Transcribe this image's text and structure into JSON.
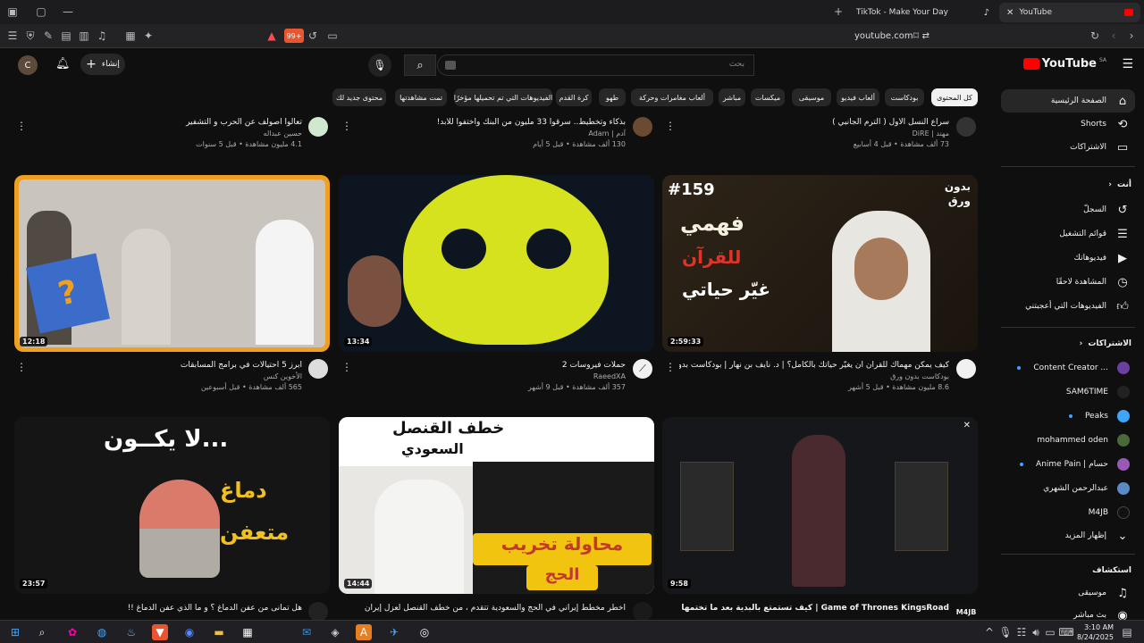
{
  "browser": {
    "tabs": [
      {
        "title": "YouTube",
        "active": true
      },
      {
        "title": "TikTok - Make Your Day",
        "active": false
      }
    ],
    "url": "youtube.com",
    "shield_count": "99+"
  },
  "masthead": {
    "search_placeholder": "بحث",
    "create_label": "إنشاء",
    "avatar_letter": "C",
    "logo_text": "YouTube",
    "logo_region": "SA"
  },
  "chips": [
    "كل المحتوى",
    "بودكاست",
    "ألعاب فيديو",
    "موسيقى",
    "ميكسات",
    "مباشر",
    "ألعاب مغامرات وحركة",
    "طهو",
    "كرة القدم",
    "الفيديوهات التي تم تحميلها مؤخرًا",
    "تمت مشاهدتها",
    "محتوى جديد لك"
  ],
  "sidebar": {
    "main": [
      {
        "label": "الصفحة الرئيسية",
        "icon": "home-icon"
      },
      {
        "label": "Shorts",
        "icon": "shorts-icon"
      },
      {
        "label": "الاشتراكات",
        "icon": "subscriptions-icon"
      }
    ],
    "you_title": "أنت",
    "you": [
      {
        "label": "السجلّ",
        "icon": "history-icon"
      },
      {
        "label": "قوائم التشغيل",
        "icon": "playlist-icon"
      },
      {
        "label": "فيديوهاتك",
        "icon": "your-videos-icon"
      },
      {
        "label": "المشاهدة لاحقًا",
        "icon": "watch-later-icon"
      },
      {
        "label": "الفيديوهات التي أعجبتني",
        "icon": "like-icon"
      }
    ],
    "subs_title": "الاشتراكات",
    "subs": [
      {
        "label": "Content Creator ...",
        "color": "#6b3fa0",
        "live": true
      },
      {
        "label": "SAM6TIME",
        "color": "#222222",
        "live": false
      },
      {
        "label": "Peaks",
        "color": "#3ea6ff",
        "live": true
      },
      {
        "label": "mohammed oden",
        "color": "#4a6a3a",
        "live": false
      },
      {
        "label": "Anime Pain | حسام",
        "color": "#9b59b6",
        "live": true
      },
      {
        "label": "عبدالرحمن الشهري",
        "color": "#5a8ac6",
        "live": false
      },
      {
        "label": "M4JB",
        "color": "#111111",
        "live": false
      }
    ],
    "show_more": "إظهار المزيد",
    "explore_title": "استكشاف",
    "explore": [
      {
        "label": "موسيقى",
        "icon": "music-icon"
      },
      {
        "label": "بث مباشر",
        "icon": "live-icon"
      }
    ]
  },
  "top_row": [
    {
      "title": "سراع النسل الأول ( الترم الجانبي )",
      "channel": "مهند | DiRE",
      "stats": "73 ألف مشاهدة • قبل 4 أسابيع",
      "avatar_color": "#333333"
    },
    {
      "title": "بذكاء وتخطيط.. سرقوا 33 مليون من البنك واختفوا للأبد!",
      "channel": "آدم | Adam",
      "stats": "130 ألف مشاهدة • قبل 5 أيام",
      "avatar_color": "#6a4a30"
    },
    {
      "title": "تعالوا أصولف عن الحرب و التشفير",
      "channel": "حسين عبداله",
      "stats": "4.1 مليون مشاهدة • قبل 5 سنوات",
      "avatar_color": "#cfe8cf"
    }
  ],
  "videos": [
    {
      "title": "كيف يمكن مهماك للقرآن أن يغيّر حياتك بالكامل؟ | د. نايف بن نهار | بودكاست بدون ورق",
      "channel": "بودكاست بدون ورق",
      "stats": "8.6 مليون مشاهدة • قبل 5 أشهر",
      "duration": "2:59:33",
      "avatar_color": "#f1f1f1",
      "thumb_text": [
        "#159",
        "فهمي",
        "للقرآن",
        "غيّر حياتي",
        "بدون",
        "ورق"
      ]
    },
    {
      "title": "حملات فيروسات 2",
      "channel": "RaeedXA",
      "stats": "357 ألف مشاهدة • قبل 9 أشهر",
      "duration": "13:34",
      "avatar_color": "#f1f1f1",
      "thumb_text": []
    },
    {
      "title": "أبرز 5 احتيالات في برامج المسابقات",
      "channel": "الأخوين كنس",
      "stats": "565 ألف مشاهدة • قبل أسبوعين",
      "duration": "12:18",
      "avatar_color": "#dddddd",
      "thumb_text": [
        "?"
      ]
    },
    {
      "title": "Game of Thrones KingsRoad | كيف تستمتع بالبدية بعد ما تختمها لحية",
      "channel": "M4JB",
      "stats": "",
      "duration": "9:58",
      "avatar_color": "#111111",
      "thumb_text": []
    },
    {
      "title": "أخطر مخطط إيراني في الحج والسعودية تتقدم ، من خطف القنصل لعزل إيران",
      "channel": "",
      "stats": "",
      "duration": "14:44",
      "avatar_color": "#1a1a1a",
      "thumb_text": [
        "خطف القنصل",
        "السعودي",
        "محاولة تخريب",
        "الحج"
      ]
    },
    {
      "title": "هل تمانى من عفن الدماغ ؟ و ما الذي عفن الدماغ !!",
      "channel": "",
      "stats": "",
      "duration": "23:57",
      "avatar_color": "#222222",
      "thumb_text": [
        "لا يكــون...",
        "دماغ",
        "متعفن"
      ]
    }
  ],
  "taskbar": {
    "time": "3:10 AM",
    "date": "8/24/2025"
  },
  "colors": {
    "yt_red": "#ff0000",
    "accent_blue": "#3ea6ff"
  }
}
